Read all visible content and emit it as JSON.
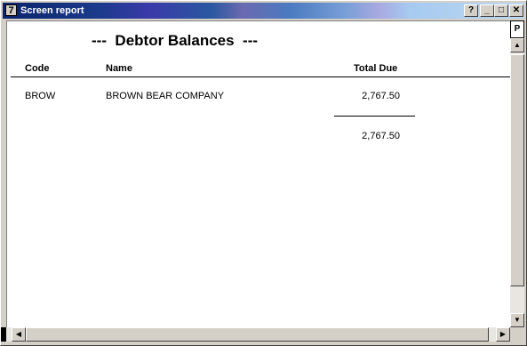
{
  "window": {
    "title": "Screen report",
    "app_icon": "7"
  },
  "titlebar_buttons": {
    "help": "?",
    "minimize": "_",
    "maximize": "□",
    "close": "✕"
  },
  "report": {
    "title": "---  Debtor Balances  ---",
    "columns": {
      "code": "Code",
      "name": "Name",
      "total_due": "Total Due"
    },
    "rows": [
      {
        "code": "BROW",
        "name": "BROWN BEAR COMPANY",
        "total_due": "2,767.50"
      }
    ],
    "grand_total": "2,767.50"
  },
  "scrollbar": {
    "page_marker": "P",
    "up": "▲",
    "down": "▼",
    "left": "◀",
    "right": "▶"
  }
}
